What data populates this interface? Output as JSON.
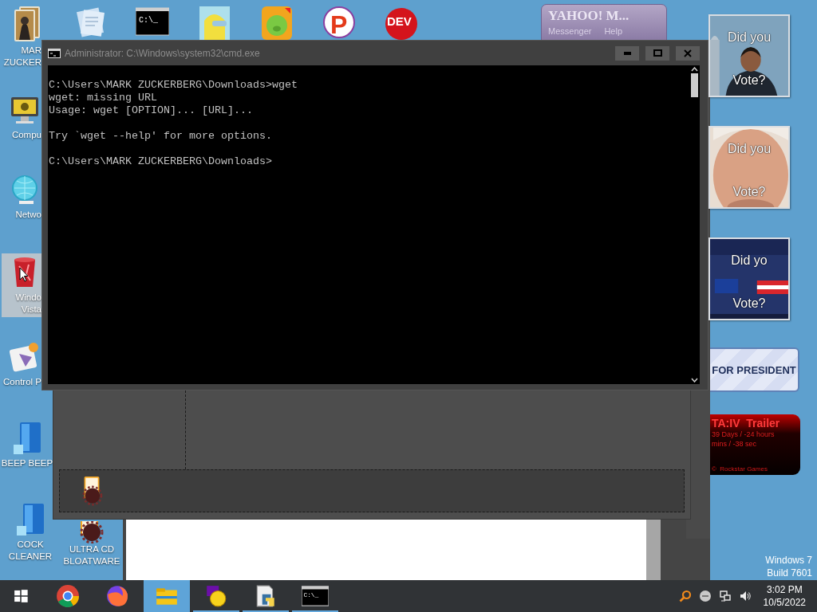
{
  "desktop_icons_left": [
    {
      "kind": "book",
      "label_lines": [
        "MAR",
        "ZUCKER"
      ],
      "selected": false
    },
    {
      "kind": "computer",
      "label_lines": [
        "Compu"
      ],
      "selected": false
    },
    {
      "kind": "network",
      "label_lines": [
        "Netwo"
      ],
      "selected": false
    },
    {
      "kind": "bin",
      "label_lines": [
        "Windo",
        "Vista"
      ],
      "selected": true
    },
    {
      "kind": "control",
      "label_lines": [
        "Control P"
      ],
      "selected": false
    },
    {
      "kind": "dvd",
      "label_lines": [
        "BEEP BEEP"
      ],
      "selected": false
    },
    {
      "kind": "dvd",
      "label_lines": [
        "COCK",
        "CLEANER"
      ],
      "selected": false
    },
    {
      "kind": "bloat",
      "label_lines": [
        "ULTRA CD",
        "BLOATWARE"
      ],
      "selected": false
    }
  ],
  "desktop_icons_top": [
    {
      "kind": "book"
    },
    {
      "kind": "notes"
    },
    {
      "kind": "console",
      "text": "C:\\_"
    },
    {
      "kind": "folder"
    },
    {
      "kind": "game"
    },
    {
      "kind": "logo",
      "text": "P"
    },
    {
      "kind": "badge",
      "text": "DEV"
    }
  ],
  "yahoo_window": {
    "title": "YAHOO! M...",
    "menu": [
      "Messenger",
      "Help"
    ]
  },
  "cmd_window": {
    "title": "Administrator: C:\\Windows\\system32\\cmd.exe",
    "output_blocks": [
      [
        "C:\\Users\\MARK ZUCKERBERG\\Downloads>wget",
        "wget: missing URL",
        "Usage: wget [OPTION]... [URL]..."
      ],
      [
        "Try `wget --help' for more options."
      ],
      [
        "C:\\Users\\MARK ZUCKERBERG\\Downloads>"
      ]
    ]
  },
  "gadgets": [
    {
      "top_text": "Did you",
      "bottom_text": "Vote?"
    },
    {
      "top_text": "Did you",
      "bottom_text": "Vote?"
    },
    {
      "top_text": "Did yo",
      "bottom_text": "Vote?"
    },
    {
      "kind": "banner",
      "text": "FOR PRESIDENT"
    },
    {
      "kind": "countdown",
      "title": "TA:IV  Trailer",
      "lines": [
        "39 Days / -24 hours",
        "mins / -38 sec"
      ],
      "footer": "©  Rockstar Games"
    }
  ],
  "windows_version": [
    "Windows 7",
    "Build 7601"
  ],
  "taskbar": {
    "items": [
      {
        "kind": "start",
        "selected": false,
        "running": false
      },
      {
        "kind": "chrome",
        "selected": false,
        "running": false
      },
      {
        "kind": "firefox",
        "selected": false,
        "running": false
      },
      {
        "kind": "explorer",
        "selected": true,
        "running": false
      },
      {
        "kind": "yahoo",
        "selected": false,
        "running": true
      },
      {
        "kind": "python",
        "selected": false,
        "running": true
      },
      {
        "kind": "cmd",
        "selected": false,
        "running": true,
        "text": "C:\\_"
      }
    ],
    "tray": {
      "time": "3:02 PM",
      "date": "10/5/2022"
    }
  }
}
